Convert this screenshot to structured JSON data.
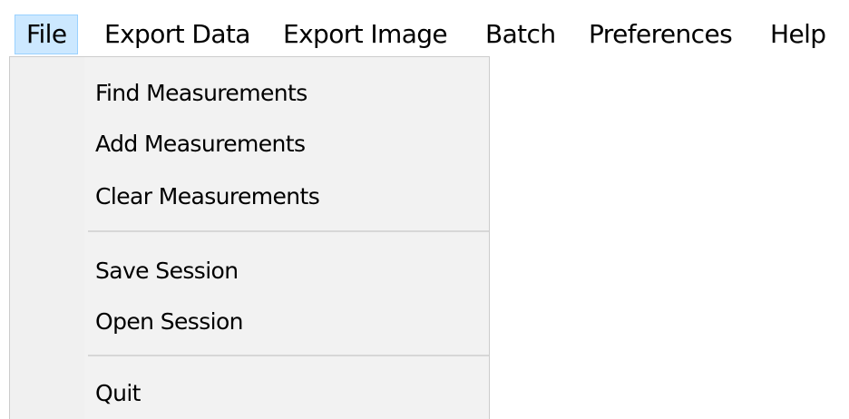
{
  "menubar": {
    "items": [
      {
        "label": "File",
        "active": true
      },
      {
        "label": "Export Data",
        "active": false
      },
      {
        "label": "Export Image",
        "active": false
      },
      {
        "label": "Batch",
        "active": false
      },
      {
        "label": "Preferences",
        "active": false
      },
      {
        "label": "Help",
        "active": false
      }
    ]
  },
  "file_menu": {
    "items": [
      {
        "label": "Find Measurements"
      },
      {
        "label": "Add Measurements"
      },
      {
        "label": "Clear Measurements"
      },
      {
        "label": "Save Session"
      },
      {
        "label": "Open Session"
      },
      {
        "label": "Quit"
      }
    ]
  },
  "colors": {
    "active_menu_bg": "#cce8ff",
    "active_menu_border": "#99d1ff",
    "dropdown_bg": "#f2f2f2",
    "separator": "#d7d7d7"
  }
}
